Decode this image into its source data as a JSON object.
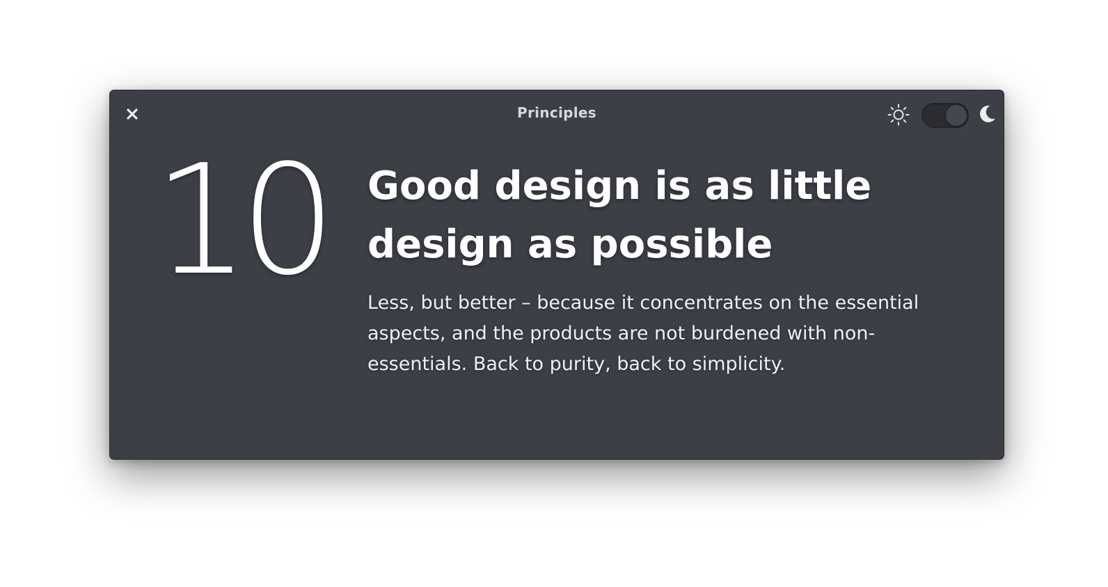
{
  "window": {
    "title": "Principles"
  },
  "header": {
    "close_icon": "close-icon",
    "light_icon": "sun-icon",
    "dark_icon": "moon-icon",
    "theme_toggle_state": "dark"
  },
  "principle": {
    "number": "10",
    "headline": "Good design is as little design as possible",
    "description": "Less, but better – because it concentrates on the essential aspects, and the products are not burdened with non-essentials. Back to purity, back to simplicity."
  },
  "colors": {
    "window_background": "#3d3f47",
    "text": "#ffffff",
    "title": "#d8d9dc"
  }
}
